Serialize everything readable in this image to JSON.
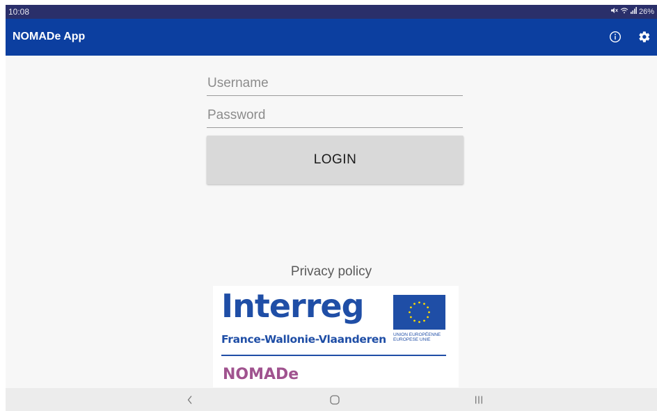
{
  "status_bar": {
    "time": "10:08",
    "battery": "26%"
  },
  "app_bar": {
    "title": "NOMADe App",
    "actions": [
      {
        "icon": "info-icon"
      },
      {
        "icon": "gear-icon"
      }
    ]
  },
  "login_form": {
    "username_placeholder": "Username",
    "password_placeholder": "Password",
    "login_label": "LOGIN"
  },
  "privacy_link": "Privacy policy",
  "logo": {
    "program": "Interreg",
    "region": "France-Wallonie-Vlaanderen",
    "eu_line1": "UNION EUROPÉENNE",
    "eu_line2": "EUROPESE UNIE",
    "project": "NOMADe"
  },
  "nav_bar": {
    "icons": [
      "back-icon",
      "home-icon",
      "recents-icon"
    ]
  },
  "colors": {
    "status_bar": "#2a2f6a",
    "app_bar": "#0c3fa0",
    "background": "#f7f7f7",
    "login_button": "#d9d9d9",
    "interreg_blue": "#1f4ea6",
    "nomade_purple": "#a0538f"
  }
}
